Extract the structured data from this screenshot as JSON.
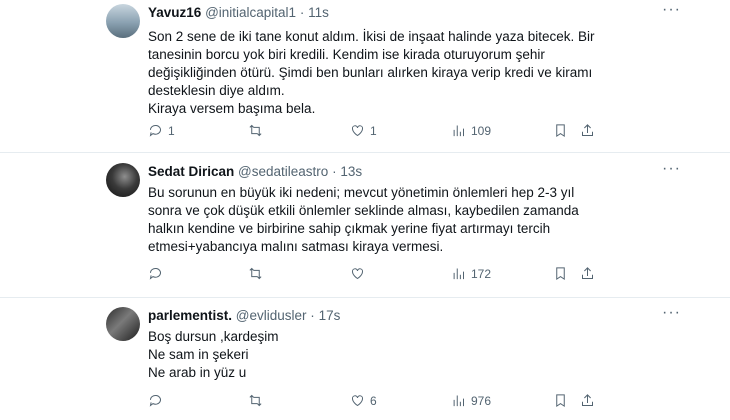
{
  "tweets": [
    {
      "name": "Yavuz16",
      "handle": "@initialcapital1",
      "time": "11s",
      "lines": [
        "Son 2 sene de iki tane konut aldım. İkisi de inşaat halinde yaza bitecek. Bir",
        "tanesinin borcu yok biri kredili. Kendim ise kirada oturuyorum şehir",
        "değişikliğinden ötürü. Şimdi ben bunları alırken kiraya verip kredi ve kiramı",
        "desteklesin diye aldım.",
        "Kiraya versem başıma bela."
      ],
      "replies": "1",
      "retweets": "",
      "likes": "1",
      "views": "109"
    },
    {
      "name": "Sedat Dirican",
      "handle": "@sedatileastro",
      "time": "13s",
      "lines": [
        "Bu sorunun en büyük iki nedeni; mevcut yönetimin önlemleri hep 2-3 yıl",
        "sonra ve çok düşük etkili önlemler seklinde alması, kaybedilen zamanda",
        "halkın kendine ve birbirine sahip çıkmak yerine fiyat artırmayı tercih",
        "etmesi+yabancıya malını satması kiraya vermesi."
      ],
      "replies": "",
      "retweets": "",
      "likes": "",
      "views": "172"
    },
    {
      "name": "parlementist.",
      "handle": "@evlidusler",
      "time": "17s",
      "lines": [
        "Boş dursun ,kardeşim",
        "Ne sam in şekeri",
        "Ne arab in yüz u"
      ],
      "replies": "",
      "retweets": "",
      "likes": "6",
      "views": "976"
    }
  ],
  "separator": "·",
  "more_glyph": "···",
  "colors": {
    "text": "#0f1419",
    "secondary": "#536471",
    "divider": "#e6ecf0"
  }
}
